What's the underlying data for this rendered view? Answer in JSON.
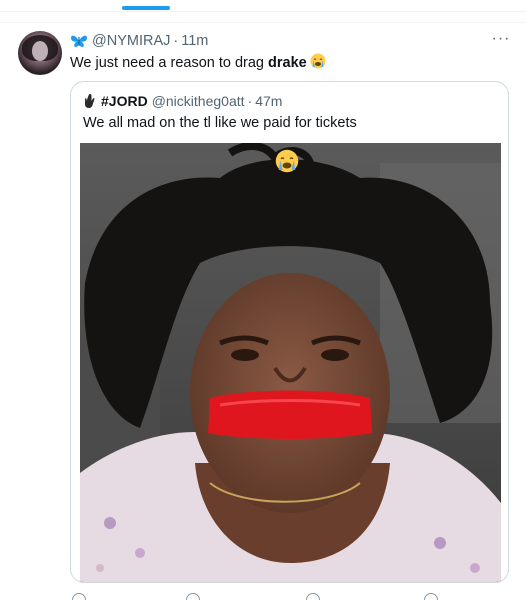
{
  "tweet": {
    "handle": "@NYMIRAJ",
    "separator": "·",
    "time": "11m",
    "text_before": "We just need a reason to drag ",
    "text_bold": "drake",
    "more_label": "···"
  },
  "quote": {
    "name": "#JORD",
    "handle": "@nickitheg0att",
    "separator": "·",
    "time": "47m",
    "text": "We all mad on the tl like we paid for  tickets"
  },
  "colors": {
    "accent": "#1d9bf0",
    "muted": "#536471",
    "tape": "#e0161f"
  },
  "icons": [
    "butterfly-icon",
    "crying-emoji-icon",
    "hand-icon",
    "more-icon",
    "reply-icon",
    "retweet-icon",
    "like-icon",
    "share-icon"
  ]
}
